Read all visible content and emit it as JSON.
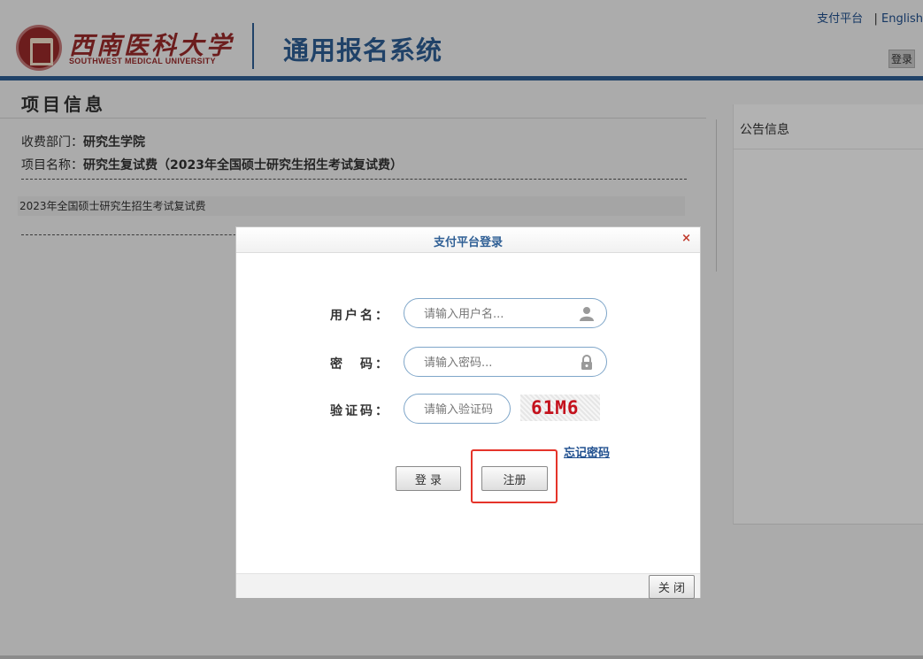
{
  "header": {
    "logo_cn": "西南医科大学",
    "logo_en": "SOUTHWEST MEDICAL UNIVERSITY",
    "system_title": "通用报名系统",
    "top_links": {
      "payment_platform": "支付平台",
      "separator": "|",
      "english": "English"
    },
    "login_label": "登录",
    "accent_color": "#2f5f95"
  },
  "project": {
    "section_title": "项目信息",
    "department_label": "收费部门：",
    "department_value": "研究生学院",
    "name_label": "项目名称：",
    "name_value": "研究生复试费（2023年全国硕士研究生招生考试复试费）",
    "description": "2023年全国硕士研究生招生考试复试费"
  },
  "notice": {
    "title": "公告信息"
  },
  "dialog": {
    "title": "支付平台登录",
    "close_x": "×",
    "username_label": "用户名：",
    "username_placeholder": "请输入用户名...",
    "password_label": "密　码：",
    "password_placeholder": "请输入密码...",
    "captcha_label": "验证码：",
    "captcha_placeholder": "请输入验证码",
    "captcha_text": "61M6",
    "forgot_password": "忘记密码",
    "login_button": "登 录",
    "register_button": "注册",
    "close_button": "关 闭",
    "icons": {
      "username": "user-icon",
      "password": "lock-icon"
    },
    "highlight_color": "#e5342a"
  }
}
